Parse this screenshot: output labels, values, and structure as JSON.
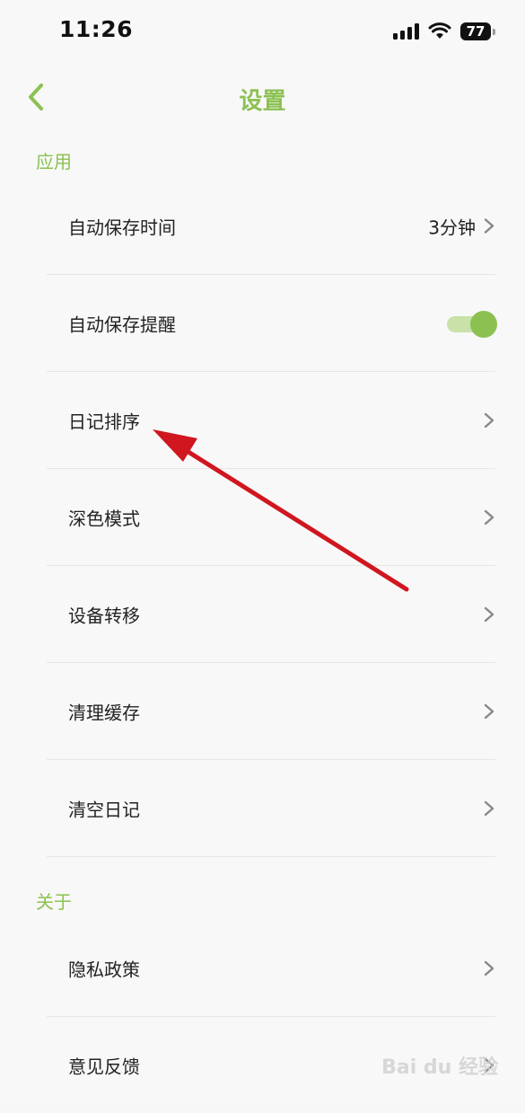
{
  "status_bar": {
    "time": "11:26",
    "battery": "77"
  },
  "nav": {
    "title": "设置"
  },
  "sections": [
    {
      "header": "应用",
      "items": [
        {
          "label": "自动保存时间",
          "value": "3分钟",
          "control": "chevron"
        },
        {
          "label": "自动保存提醒",
          "control": "toggle",
          "toggle_on": true
        },
        {
          "label": "日记排序",
          "control": "chevron"
        },
        {
          "label": "深色模式",
          "control": "chevron"
        },
        {
          "label": "设备转移",
          "control": "chevron"
        },
        {
          "label": "清理缓存",
          "control": "chevron"
        },
        {
          "label": "清空日记",
          "control": "chevron"
        }
      ]
    },
    {
      "header": "关于",
      "items": [
        {
          "label": "隐私政策",
          "control": "chevron"
        },
        {
          "label": "意见反馈",
          "control": "chevron"
        }
      ]
    }
  ],
  "theme": {
    "accent": "#8cc152",
    "toggle_track": "#c8e2a9",
    "annotation_arrow": "#d0161f"
  },
  "icons": {
    "back": "chevron-left-icon",
    "row_chevron": "chevron-right-icon",
    "signal": "cellular-signal-icon",
    "wifi": "wifi-icon",
    "battery": "battery-icon"
  },
  "watermark": "Bai du 经验"
}
